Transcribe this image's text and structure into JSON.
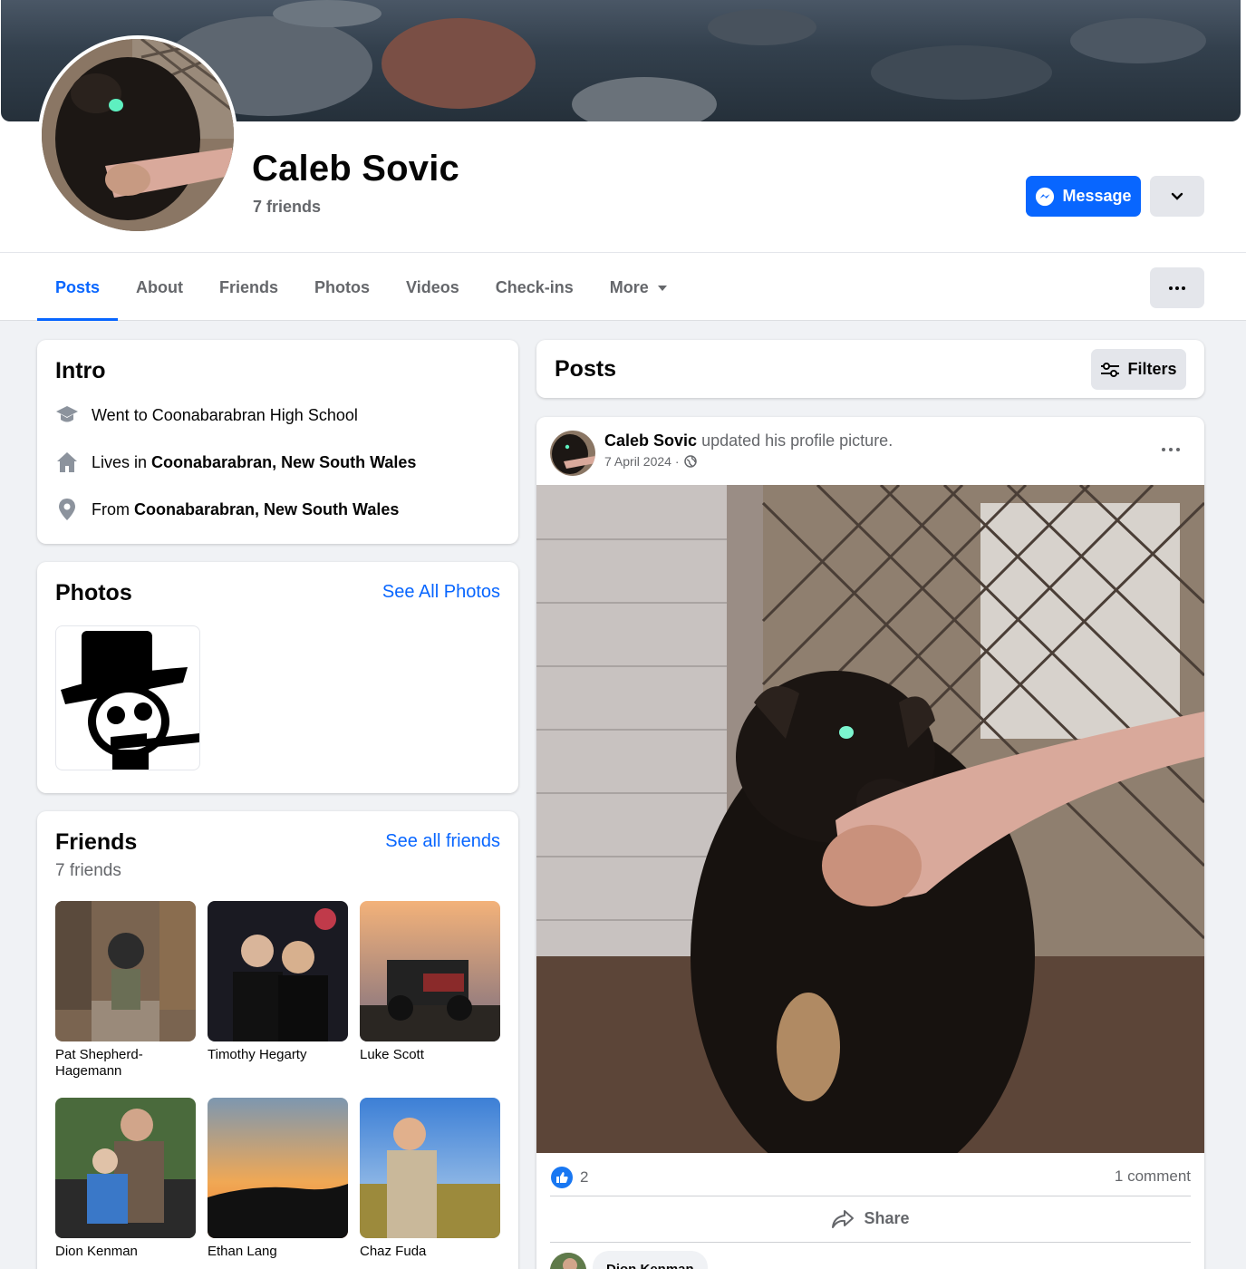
{
  "profile": {
    "name": "Caleb Sovic",
    "friends_count": "7 friends"
  },
  "actions": {
    "message_label": "Message"
  },
  "tabs": [
    {
      "label": "Posts"
    },
    {
      "label": "About"
    },
    {
      "label": "Friends"
    },
    {
      "label": "Photos"
    },
    {
      "label": "Videos"
    },
    {
      "label": "Check-ins"
    },
    {
      "label": "More"
    }
  ],
  "intro": {
    "title": "Intro",
    "school": "Went to Coonabarabran High School",
    "lives_prefix": "Lives in ",
    "lives_place": "Coonabarabran, New South Wales",
    "from_prefix": "From ",
    "from_place": "Coonabarabran, New South Wales"
  },
  "photos": {
    "title": "Photos",
    "see_all": "See All Photos"
  },
  "friends": {
    "title": "Friends",
    "count": "7 friends",
    "see_all": "See all friends",
    "list": [
      {
        "name": "Pat Shepherd-Hagemann"
      },
      {
        "name": "Timothy Hegarty"
      },
      {
        "name": "Luke Scott"
      },
      {
        "name": "Dion Kenman"
      },
      {
        "name": "Ethan Lang"
      },
      {
        "name": "Chaz Fuda"
      }
    ]
  },
  "posts_header": {
    "title": "Posts",
    "filters_label": "Filters"
  },
  "post": {
    "author": "Caleb Sovic",
    "action": "updated his profile picture.",
    "date": "7 April 2024 ·",
    "reactions_count": "2",
    "comments_count": "1 comment",
    "share_label": "Share",
    "commenter_name": "Dion Kenman"
  },
  "colors": {
    "accent": "#0866ff",
    "secondary_text": "#65676b",
    "page_bg": "#f0f2f5"
  }
}
